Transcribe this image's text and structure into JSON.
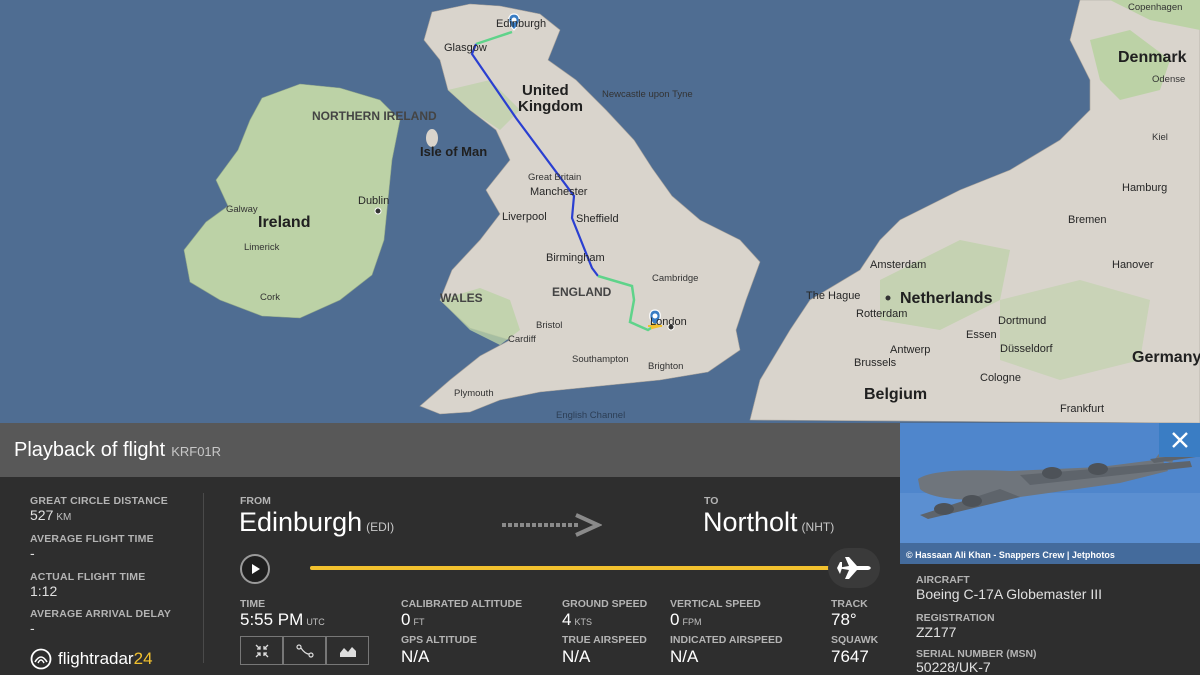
{
  "map": {
    "labels": {
      "edinburgh": "Edinburgh",
      "glasgow": "Glasgow",
      "united_kingdom": "United\nKingdom",
      "newcastle": "Newcastle upon Tyne",
      "northern_ireland": "NORTHERN IRELAND",
      "isle_of_man": "Isle of Man",
      "ireland": "Ireland",
      "dublin": "Dublin",
      "galway": "Galway",
      "limerick": "Limerick",
      "cork": "Cork",
      "great_britain": "Great Britain",
      "manchester": "Manchester",
      "liverpool": "Liverpool",
      "sheffield": "Sheffield",
      "birmingham": "Birmingham",
      "wales": "WALES",
      "england": "ENGLAND",
      "cambridge": "Cambridge",
      "london": "London",
      "bristol": "Bristol",
      "cardiff": "Cardiff",
      "southampton": "Southampton",
      "brighton": "Brighton",
      "plymouth": "Plymouth",
      "english_channel": "English Channel",
      "denmark": "Denmark",
      "odense": "Odense",
      "kiel": "Kiel",
      "hamburg": "Hamburg",
      "bremen": "Bremen",
      "hanover": "Hanover",
      "amsterdam": "Amsterdam",
      "the_hague": "The Hague",
      "netherlands": "Netherlands",
      "rotterdam": "Rotterdam",
      "dortmund": "Dortmund",
      "antwerp": "Antwerp",
      "essen": "Essen",
      "dusseldorf": "Düsseldorf",
      "brussels": "Brussels",
      "cologne": "Cologne",
      "belgium": "Belgium",
      "frankfurt": "Frankfurt",
      "germany": "Germany",
      "copenhagen": "Copenhagen"
    },
    "colors": {
      "sea": "#4f6d92",
      "land": "#d9d4cc",
      "land_green": "#bcd2a6",
      "track_blue": "#2a3fd1",
      "track_green": "#5fd38a"
    }
  },
  "header": {
    "title": "Playback of flight",
    "callsign": "KRF01R"
  },
  "stats": {
    "great_circle_label": "GREAT CIRCLE DISTANCE",
    "great_circle_value": "527",
    "great_circle_unit": "KM",
    "avg_flight_time_label": "AVERAGE FLIGHT TIME",
    "avg_flight_time_value": "-",
    "actual_flight_time_label": "ACTUAL FLIGHT TIME",
    "actual_flight_time_value": "1:12",
    "avg_arrival_delay_label": "AVERAGE ARRIVAL DELAY",
    "avg_arrival_delay_value": "-"
  },
  "route": {
    "from_label": "FROM",
    "from_city": "Edinburgh",
    "from_code": "(EDI)",
    "to_label": "TO",
    "to_city": "Northolt",
    "to_code": "(NHT)"
  },
  "playback": {
    "progress": 1.0
  },
  "metrics": {
    "time_label": "TIME",
    "time_value": "5:55 PM",
    "time_unit": "UTC",
    "cal_alt_label": "CALIBRATED ALTITUDE",
    "cal_alt_value": "0",
    "cal_alt_unit": "FT",
    "gps_alt_label": "GPS ALTITUDE",
    "gps_alt_value": "N/A",
    "ground_speed_label": "GROUND SPEED",
    "ground_speed_value": "4",
    "ground_speed_unit": "KTS",
    "true_airspeed_label": "TRUE AIRSPEED",
    "true_airspeed_value": "N/A",
    "vertical_speed_label": "VERTICAL SPEED",
    "vertical_speed_value": "0",
    "vertical_speed_unit": "FPM",
    "indicated_airspeed_label": "INDICATED AIRSPEED",
    "indicated_airspeed_value": "N/A",
    "track_label": "TRACK",
    "track_value": "78°",
    "squawk_label": "SQUAWK",
    "squawk_value": "7647"
  },
  "logo": {
    "text_main": "flightradar",
    "text_num": "24"
  },
  "aircraft": {
    "photo_credit": "© Hassaan Ali Khan - Snappers Crew | Jetphotos",
    "aircraft_label": "AIRCRAFT",
    "aircraft_value": "Boeing C-17A Globemaster III",
    "registration_label": "REGISTRATION",
    "registration_value": "ZZ177",
    "serial_label": "SERIAL NUMBER (MSN)",
    "serial_value": "50228/UK-7"
  },
  "icons": {
    "close": "close-icon",
    "play": "play-icon",
    "plane": "plane-icon",
    "arrow": "route-arrow-icon",
    "map_view": "collapse-icon",
    "route_view": "route-icon",
    "graph_view": "graph-icon",
    "logo": "radar-logo-icon"
  }
}
